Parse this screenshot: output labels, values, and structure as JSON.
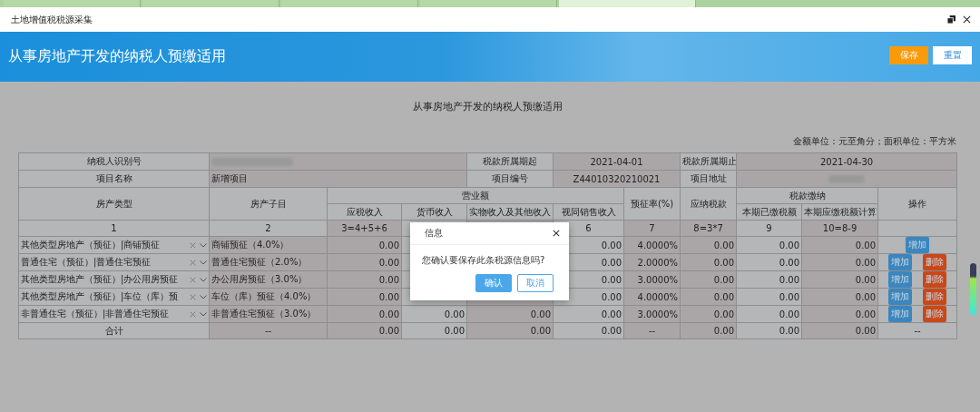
{
  "browser_tabs": [
    {
      "selected": false
    },
    {
      "selected": false
    },
    {
      "selected": false
    },
    {
      "selected": false
    },
    {
      "selected": true
    }
  ],
  "window": {
    "title": "土地增值税税源采集"
  },
  "header": {
    "title": "从事房地产开发的纳税人预缴适用",
    "buttons": [
      {
        "label": "保存",
        "kind": "primary"
      },
      {
        "label": "重置",
        "kind": "secondary"
      }
    ]
  },
  "report": {
    "title": "从事房地产开发的纳税人预缴适用",
    "unit_note": "金额单位：元至角分；面积单位：平方米",
    "info": [
      {
        "cells": [
          {
            "kind": "label",
            "text": "纳税人识别号"
          },
          {
            "kind": "redacted"
          },
          {
            "kind": "label",
            "text": "税款所属期起"
          },
          {
            "kind": "value",
            "text": "2021-04-01"
          },
          {
            "kind": "label",
            "text": "税款所属期止"
          },
          {
            "kind": "value",
            "text": "2021-04-30"
          }
        ]
      },
      {
        "cells": [
          {
            "kind": "label",
            "text": "项目名称"
          },
          {
            "kind": "value",
            "text": "新增项目"
          },
          {
            "kind": "label",
            "text": "项目编号"
          },
          {
            "kind": "value",
            "text": "Z44010320210021"
          },
          {
            "kind": "label",
            "text": "项目地址"
          },
          {
            "kind": "redacted"
          }
        ]
      }
    ],
    "columns": [
      {
        "label": "房产类型"
      },
      {
        "label": "房产子目"
      },
      {
        "label": "营业额",
        "children": [
          "应税收入",
          "货币收入",
          "实物收入及其他收入",
          "视同销售收入"
        ]
      },
      {
        "label": "预征率(%)"
      },
      {
        "label": "应纳税款"
      },
      {
        "label": "税款缴纳",
        "children": [
          "本期已缴税额",
          "本期应缴税额计算"
        ]
      },
      {
        "label": "操作"
      }
    ],
    "index_row": {
      "type": "1",
      "subitem": "2",
      "taxable_income": "3=4+5+6",
      "deemed_sales_income": "6",
      "prepay_rate": "7",
      "tax_payable": "8=3*7",
      "tax_paid": "9",
      "tax_due": "10=8-9"
    },
    "rows": [
      {
        "type": "其他类型房地产（预征）|商铺预征",
        "subitem": "商铺预征（4.0%）",
        "values": {
          "taxable_income": "0.00",
          "deemed_sales_income": "0.00",
          "prepay_rate": "4.0000%",
          "tax_payable": "0.00",
          "tax_paid": "0.00",
          "tax_due": "0.00"
        },
        "actions": [
          {
            "label": "增加",
            "kind": "add"
          }
        ]
      },
      {
        "type": "普通住宅（预征）|普通住宅预征",
        "subitem": "普通住宅预征（2.0%）",
        "values": {
          "taxable_income": "0.00",
          "deemed_sales_income": "0.00",
          "prepay_rate": "2.0000%",
          "tax_payable": "0.00",
          "tax_paid": "0.00",
          "tax_due": "0.00"
        },
        "actions": [
          {
            "label": "增加",
            "kind": "add"
          },
          {
            "label": "删除",
            "kind": "delete"
          }
        ]
      },
      {
        "type": "其他类型房地产（预征）|办公用房预征",
        "subitem": "办公用房预征（3.0%）",
        "values": {
          "taxable_income": "0.00",
          "deemed_sales_income": "0.00",
          "prepay_rate": "3.0000%",
          "tax_payable": "0.00",
          "tax_paid": "0.00",
          "tax_due": "0.00"
        },
        "actions": [
          {
            "label": "增加",
            "kind": "add"
          },
          {
            "label": "删除",
            "kind": "delete"
          }
        ]
      },
      {
        "type": "其他类型房地产（预征）|车位（库）预",
        "subitem": "车位（库）预征（4.0%）",
        "values": {
          "taxable_income": "0.00",
          "deemed_sales_income": "0.00",
          "prepay_rate": "4.0000%",
          "tax_payable": "0.00",
          "tax_paid": "0.00",
          "tax_due": "0.00"
        },
        "actions": [
          {
            "label": "增加",
            "kind": "add"
          },
          {
            "label": "删除",
            "kind": "delete"
          }
        ]
      },
      {
        "type": "非普通住宅（预征）|非普通住宅预征",
        "subitem": "非普通住宅预征（3.0%）",
        "values": {
          "taxable_income": "0.00",
          "monetary_income": "0.00",
          "in_kind_income": "0.00",
          "deemed_sales_income": "0.00",
          "prepay_rate": "3.0000%",
          "tax_payable": "0.00",
          "tax_paid": "0.00",
          "tax_due": "0.00"
        },
        "actions": [
          {
            "label": "增加",
            "kind": "add"
          },
          {
            "label": "删除",
            "kind": "delete"
          }
        ]
      }
    ],
    "total": {
      "label": "合计",
      "cells": [
        "--",
        "0.00",
        "0.00",
        "0.00",
        "0.00",
        "--",
        "0.00",
        "0.00",
        "0.00",
        "--"
      ]
    }
  },
  "dialog": {
    "title": "信息",
    "message": "您确认要保存此条税源信息吗?",
    "buttons": [
      {
        "label": "确认",
        "kind": "primary"
      },
      {
        "label": "取消",
        "kind": "secondary"
      }
    ]
  }
}
